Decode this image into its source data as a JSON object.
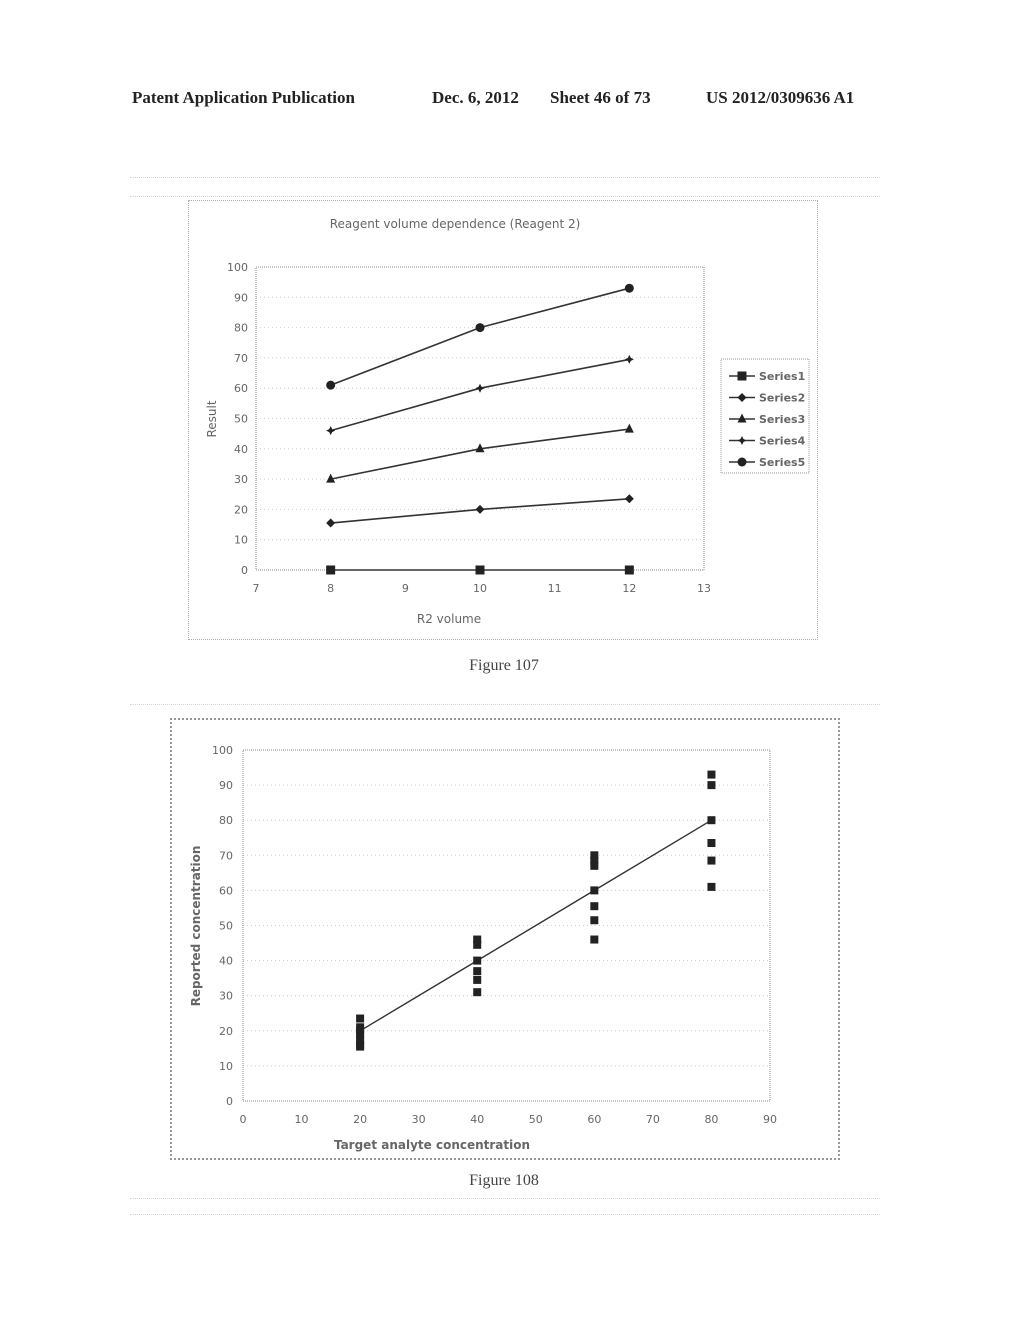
{
  "header": {
    "publication": "Patent Application Publication",
    "date": "Dec. 6, 2012",
    "sheet": "Sheet 46 of 73",
    "number": "US 2012/0309636 A1"
  },
  "figures": {
    "fig107_caption": "Figure 107",
    "fig108_caption": "Figure 108"
  },
  "chart_data": [
    {
      "type": "line",
      "title": "Reagent volume dependence (Reagent 2)",
      "xlabel": "R2 volume",
      "ylabel": "Result",
      "xlim": [
        7,
        13
      ],
      "ylim": [
        0,
        100
      ],
      "xticks": [
        "7",
        "8",
        "9",
        "10",
        "11",
        "12",
        "13"
      ],
      "yticks": [
        "0",
        "10",
        "20",
        "30",
        "40",
        "50",
        "60",
        "70",
        "80",
        "90",
        "100"
      ],
      "grid": true,
      "legend": "right",
      "x": [
        8,
        10,
        12
      ],
      "series": [
        {
          "name": "Series1",
          "marker": "square",
          "values": [
            0,
            0,
            0
          ]
        },
        {
          "name": "Series2",
          "marker": "diamond",
          "values": [
            15.5,
            20,
            23.5
          ]
        },
        {
          "name": "Series3",
          "marker": "triangle",
          "values": [
            30,
            40,
            46.5
          ]
        },
        {
          "name": "Series4",
          "marker": "star",
          "values": [
            46,
            60,
            69.5
          ]
        },
        {
          "name": "Series5",
          "marker": "circle",
          "values": [
            61,
            80,
            93
          ]
        }
      ]
    },
    {
      "type": "scatter",
      "title": "",
      "xlabel": "Target analyte concentration",
      "ylabel": "Reported concentration",
      "xlim": [
        0,
        90
      ],
      "ylim": [
        0,
        100
      ],
      "xticks": [
        "0",
        "10",
        "20",
        "30",
        "40",
        "50",
        "60",
        "70",
        "80",
        "90"
      ],
      "yticks": [
        "0",
        "10",
        "20",
        "30",
        "40",
        "50",
        "60",
        "70",
        "80",
        "90",
        "100"
      ],
      "grid": true,
      "legend": "none",
      "points": [
        {
          "x": 20,
          "y": 23.5
        },
        {
          "x": 20,
          "y": 21
        },
        {
          "x": 20,
          "y": 20
        },
        {
          "x": 20,
          "y": 19
        },
        {
          "x": 20,
          "y": 17.5
        },
        {
          "x": 20,
          "y": 16
        },
        {
          "x": 20,
          "y": 15.5
        },
        {
          "x": 40,
          "y": 46
        },
        {
          "x": 40,
          "y": 44.5
        },
        {
          "x": 40,
          "y": 40
        },
        {
          "x": 40,
          "y": 37
        },
        {
          "x": 40,
          "y": 34.5
        },
        {
          "x": 40,
          "y": 31
        },
        {
          "x": 60,
          "y": 70
        },
        {
          "x": 60,
          "y": 68.5
        },
        {
          "x": 60,
          "y": 67
        },
        {
          "x": 60,
          "y": 60
        },
        {
          "x": 60,
          "y": 55.5
        },
        {
          "x": 60,
          "y": 51.5
        },
        {
          "x": 60,
          "y": 46
        },
        {
          "x": 80,
          "y": 93
        },
        {
          "x": 80,
          "y": 90
        },
        {
          "x": 80,
          "y": 80
        },
        {
          "x": 80,
          "y": 73.5
        },
        {
          "x": 80,
          "y": 68.5
        },
        {
          "x": 80,
          "y": 61
        }
      ],
      "trendline": {
        "x": [
          20,
          40,
          60,
          80
        ],
        "y": [
          20,
          40,
          60,
          80
        ]
      }
    }
  ]
}
